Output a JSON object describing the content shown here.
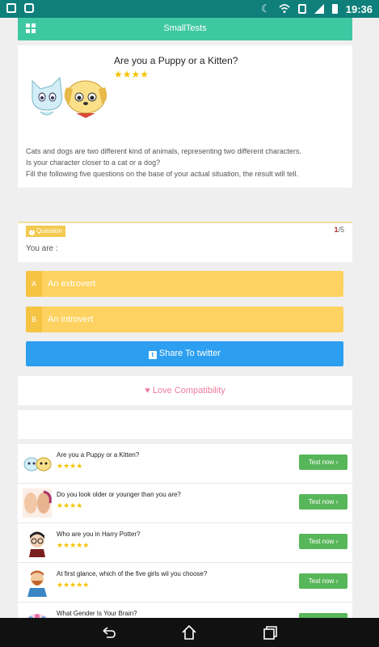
{
  "statusbar": {
    "time": "19:36"
  },
  "header": {
    "title": "SmallTests"
  },
  "intro": {
    "title": "Are you a Puppy or a Kitten?",
    "stars": "★★★★",
    "desc": [
      "Cats and dogs are two different kind of animals, representing two different characters.",
      "Is your character closer to a cat or a dog?",
      "Fill the following five questions on the base of your actual situation, the result will tell."
    ]
  },
  "question": {
    "badge": "Question",
    "current": "1",
    "total": "/5",
    "text": "You are :"
  },
  "answers": [
    {
      "letter": "A",
      "text": "An extrovert"
    },
    {
      "letter": "B",
      "text": "An introvert"
    }
  ],
  "share": {
    "icon": "t",
    "label": "Share To twitter"
  },
  "love": {
    "label": "Love Compatibility"
  },
  "list": [
    {
      "title": "Are you a Puppy or a Kitten?",
      "stars": "★★★★",
      "button": "Test now ›"
    },
    {
      "title": "Do you look older or younger than you are?",
      "stars": "★★★★",
      "button": "Test now ›"
    },
    {
      "title": "Who are you in Harry Potter?",
      "stars": "★★★★★",
      "button": "Test now ›"
    },
    {
      "title": "At first glance, which of the five girls wil you choose?",
      "stars": "★★★★★",
      "button": "Test now ›"
    },
    {
      "title": "What Gender Is Your Brain?",
      "stars": "",
      "button": ""
    }
  ],
  "colors": {
    "statusbar": "#0e7f7a",
    "header": "#3ec8a2",
    "answer": "#fdd260",
    "share": "#2d9ff0",
    "test_button": "#58b65a",
    "love": "#f07c9c"
  }
}
